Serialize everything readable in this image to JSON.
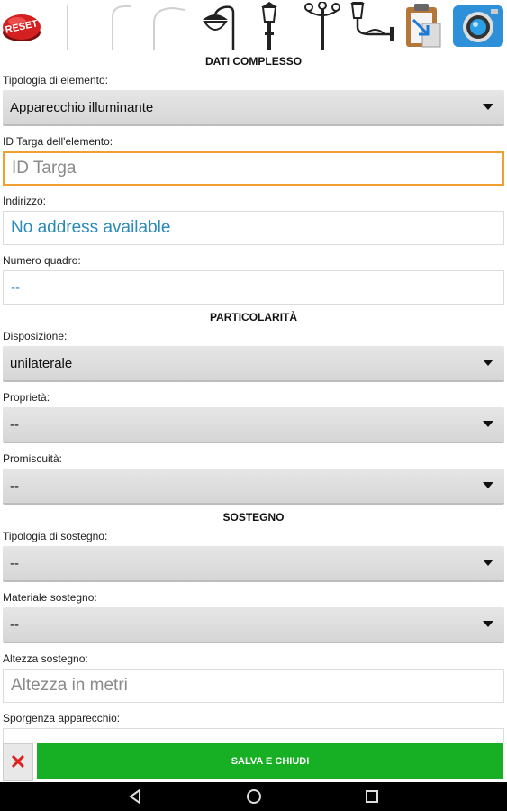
{
  "toolbar": {
    "reset_label": "RESET",
    "icons": [
      "reset-icon",
      "pole-straight-icon",
      "pole-curved-icon",
      "pole-arc-icon",
      "lamp-double-icon",
      "lantern-pole-icon",
      "lantern-triple-icon",
      "wall-lantern-icon",
      "clipboard-icon",
      "camera-icon"
    ]
  },
  "sections": {
    "dati_complesso": "DATI COMPLESSO",
    "particolarita": "PARTICOLARITÀ",
    "sostegno": "SOSTEGNO"
  },
  "fields": {
    "tipologia_label": "Tipologia di elemento:",
    "tipologia_value": "Apparecchio illuminante",
    "id_targa_label": "ID Targa dell'elemento:",
    "id_targa_placeholder": "ID Targa",
    "indirizzo_label": "Indirizzo:",
    "indirizzo_value": "No address available",
    "numero_quadro_label": "Numero quadro:",
    "numero_quadro_value": "--",
    "disposizione_label": "Disposizione:",
    "disposizione_value": "unilaterale",
    "proprieta_label": "Proprietà:",
    "proprieta_value": "--",
    "promiscuita_label": "Promiscuità:",
    "promiscuita_value": "--",
    "tipologia_sostegno_label": "Tipologia di sostegno:",
    "tipologia_sostegno_value": "--",
    "materiale_sostegno_label": "Materiale sostegno:",
    "materiale_sostegno_value": "--",
    "altezza_label": "Altezza sostegno:",
    "altezza_placeholder": "Altezza in metri",
    "sporgenza_label": "Sporgenza apparecchio:"
  },
  "actions": {
    "cancel_symbol": "✕",
    "save_label": "SALVA E CHIUDI"
  },
  "colors": {
    "save_green": "#17b024",
    "focus_orange": "#f0a030",
    "address_blue": "#2a8ab8",
    "reset_red": "#d42020"
  }
}
